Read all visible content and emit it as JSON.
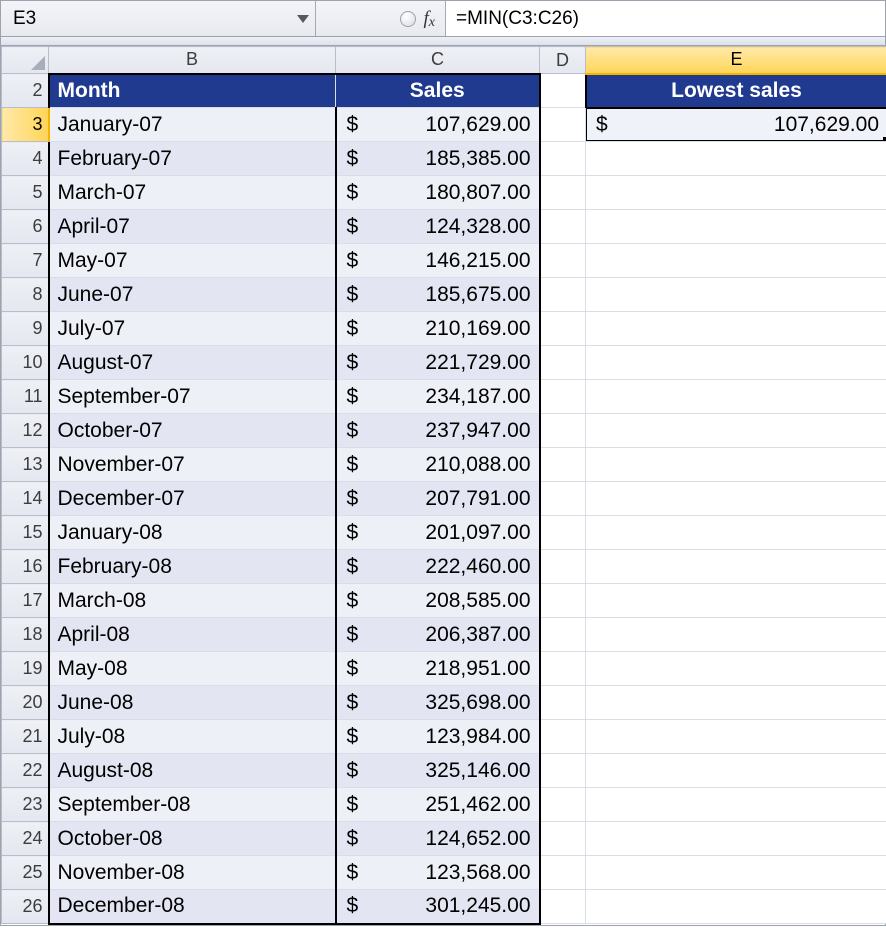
{
  "namebox": "E3",
  "formula": "=MIN(C3:C26)",
  "columns": {
    "B": "B",
    "C": "C",
    "D": "D",
    "E": "E"
  },
  "row_start": 2,
  "headers": {
    "month": "Month",
    "sales": "Sales",
    "lowest": "Lowest sales"
  },
  "currency_symbol": "$",
  "result": "107,629.00",
  "rows": [
    {
      "n": 3,
      "month": "January-07",
      "sales": "107,629.00"
    },
    {
      "n": 4,
      "month": "February-07",
      "sales": "185,385.00"
    },
    {
      "n": 5,
      "month": "March-07",
      "sales": "180,807.00"
    },
    {
      "n": 6,
      "month": "April-07",
      "sales": "124,328.00"
    },
    {
      "n": 7,
      "month": "May-07",
      "sales": "146,215.00"
    },
    {
      "n": 8,
      "month": "June-07",
      "sales": "185,675.00"
    },
    {
      "n": 9,
      "month": "July-07",
      "sales": "210,169.00"
    },
    {
      "n": 10,
      "month": "August-07",
      "sales": "221,729.00"
    },
    {
      "n": 11,
      "month": "September-07",
      "sales": "234,187.00"
    },
    {
      "n": 12,
      "month": "October-07",
      "sales": "237,947.00"
    },
    {
      "n": 13,
      "month": "November-07",
      "sales": "210,088.00"
    },
    {
      "n": 14,
      "month": "December-07",
      "sales": "207,791.00"
    },
    {
      "n": 15,
      "month": "January-08",
      "sales": "201,097.00"
    },
    {
      "n": 16,
      "month": "February-08",
      "sales": "222,460.00"
    },
    {
      "n": 17,
      "month": "March-08",
      "sales": "208,585.00"
    },
    {
      "n": 18,
      "month": "April-08",
      "sales": "206,387.00"
    },
    {
      "n": 19,
      "month": "May-08",
      "sales": "218,951.00"
    },
    {
      "n": 20,
      "month": "June-08",
      "sales": "325,698.00"
    },
    {
      "n": 21,
      "month": "July-08",
      "sales": "123,984.00"
    },
    {
      "n": 22,
      "month": "August-08",
      "sales": "325,146.00"
    },
    {
      "n": 23,
      "month": "September-08",
      "sales": "251,462.00"
    },
    {
      "n": 24,
      "month": "October-08",
      "sales": "124,652.00"
    },
    {
      "n": 25,
      "month": "November-08",
      "sales": "123,568.00"
    },
    {
      "n": 26,
      "month": "December-08",
      "sales": "301,245.00"
    }
  ]
}
